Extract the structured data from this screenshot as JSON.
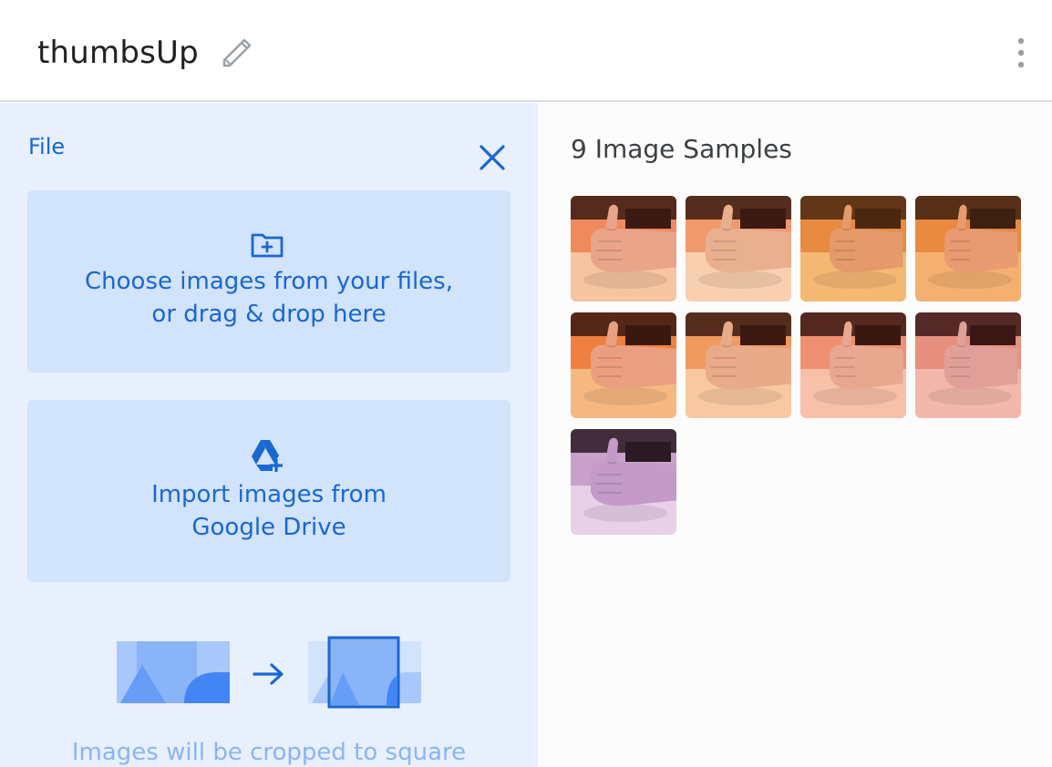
{
  "header": {
    "class_name": "thumbsUp",
    "edit_icon": "pencil-icon",
    "menu_icon": "more-vert-icon"
  },
  "upload_panel": {
    "title": "File",
    "close_icon": "close-icon",
    "files_option": {
      "icon": "folder-add-icon",
      "line1": "Choose images from your files,",
      "line2": "or drag & drop here"
    },
    "drive_option": {
      "icon": "google-drive-add-icon",
      "line1": "Import images from",
      "line2": "Google Drive"
    },
    "crop_note": "Images will be cropped to square"
  },
  "samples": {
    "title": "9 Image Samples",
    "thumbnails": [
      {
        "top": "#3a1a12",
        "bg": "#f08a5c",
        "floor": "#f6c4a0",
        "hand": "#e9a48a"
      },
      {
        "top": "#3a1a12",
        "bg": "#f09a6c",
        "floor": "#f8d0b0",
        "hand": "#e9b090"
      },
      {
        "top": "#4a2810",
        "bg": "#e88a40",
        "floor": "#f5b873",
        "hand": "#e49a6a"
      },
      {
        "top": "#3d2010",
        "bg": "#ea8a40",
        "floor": "#f4b070",
        "hand": "#e89a70"
      },
      {
        "top": "#3a1810",
        "bg": "#f08040",
        "floor": "#f6b880",
        "hand": "#eaa080"
      },
      {
        "top": "#3a1a12",
        "bg": "#f09a60",
        "floor": "#f8c8a0",
        "hand": "#e8aa88"
      },
      {
        "top": "#3a1812",
        "bg": "#f09070",
        "floor": "#f7c0a8",
        "hand": "#e8a890"
      },
      {
        "top": "#3a1816",
        "bg": "#e89080",
        "floor": "#f2b8ac",
        "hand": "#e0a098"
      },
      {
        "top": "#2a1a22",
        "bg": "#c8a0c8",
        "floor": "#e8d0e8",
        "hand": "#c49ac8"
      }
    ]
  },
  "colors": {
    "accent": "#1967d2",
    "panel_bg": "#e8f0fe",
    "box_bg": "#d2e3fc"
  }
}
